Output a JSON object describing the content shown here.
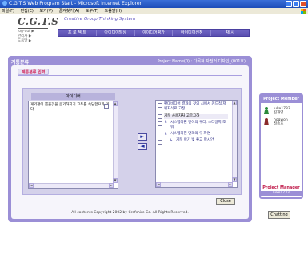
{
  "window": {
    "title": "C.G.T.S Web Program Start - Microsoft Internet Explorer",
    "menu": [
      "파일(F)",
      "편집(E)",
      "보기(V)",
      "즐겨찾기(A)",
      "도구(T)",
      "도움말(H)"
    ]
  },
  "header": {
    "logo": "C.G.T.S",
    "slogan": "Creative Group Thinking System",
    "mini_menu": [
      "log-out ▶",
      "관리자 ▶",
      "도움말 ▶"
    ],
    "nav": [
      "프 로 젝 트",
      "아이디어발상",
      "아이디어평가",
      "아이디어선정",
      "채 시"
    ]
  },
  "panel": {
    "title": "계통분류",
    "project_name": "Project Name(0) : 다목적 자전거 디자인_(001호)",
    "tab": "계통분류 입력",
    "left_header": "아이디어",
    "left_items": [
      "게기판이 뽑을것을 음기하지기 고두를 속담함요가 있다"
    ],
    "right_items": [
      "편대비디어 결과의 것의 시에서 커드적 저위지식로 고정",
      "기분 사용자처 고르고하",
      "시스템리편 면이의 우리, 스타일지 조 워",
      "시스템리편 면리의 우 파면",
      "기분 아기 빛 좋고 마시안"
    ],
    "move_right": "►",
    "move_left": "◄",
    "close": "Close",
    "footer": "All contents Copyright 2002 by Crefshire Co. All Rights Reserved."
  },
  "members": {
    "title": "Project Member",
    "list": [
      {
        "id": "luke1733",
        "name": "김재영"
      },
      {
        "id": "hogwon",
        "name": "정송호"
      }
    ],
    "manager_title": "Project Manager",
    "manager_name": "luke1733",
    "chatting": "Chatting"
  }
}
